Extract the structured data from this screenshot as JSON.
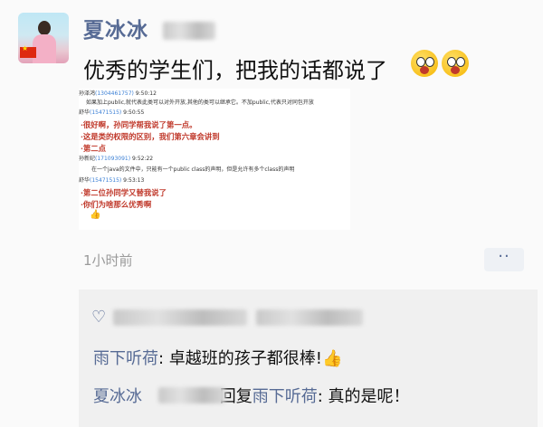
{
  "post": {
    "author": "夏冰冰",
    "text": "优秀的学生们，把我的话都说了",
    "time": "1小时前",
    "more_label": "··"
  },
  "screenshot": {
    "entries": [
      {
        "name": "孙泽鸿",
        "id": "(1304461757)",
        "time": "9:50:12",
        "lines": [
          "如果加上public,就代表此类可以对外开放,其他的类可以继承它。不加public,代表只对同包开放"
        ],
        "style": "normal"
      },
      {
        "name": "舒华",
        "id": "(15471515)",
        "time": "9:50:55",
        "lines": [
          "·很好啊，孙同学帮我说了第一点。",
          "·这是类的权限的区别，我们第六章会讲到",
          "·第二点"
        ],
        "style": "red"
      },
      {
        "name": "孙新纪",
        "id": "(171093091)",
        "time": "9:52:22",
        "lines": [
          "在一个java的文件中，只能有一个public class的声明，但是允许有多个class的声明"
        ],
        "style": "normal"
      },
      {
        "name": "舒华",
        "id": "(15471515)",
        "time": "9:53:13",
        "lines": [
          "·第二位孙同学又替我说了",
          "·你们为啥那么优秀啊"
        ],
        "style": "red"
      }
    ]
  },
  "comments": [
    {
      "author": "雨下听荷",
      "text": "卓越班的孩子都很棒!"
    },
    {
      "author": "夏冰冰",
      "reply_word": "回复",
      "reply_to": "雨下听荷",
      "text": "真的是呢！"
    }
  ],
  "colors": {
    "link": "#576b95",
    "red_text": "#c0392b",
    "background": "#fafafa"
  },
  "icons": [
    "heart-icon",
    "thumbs-up-icon",
    "more-dots-icon",
    "smile-emoji-icon"
  ]
}
